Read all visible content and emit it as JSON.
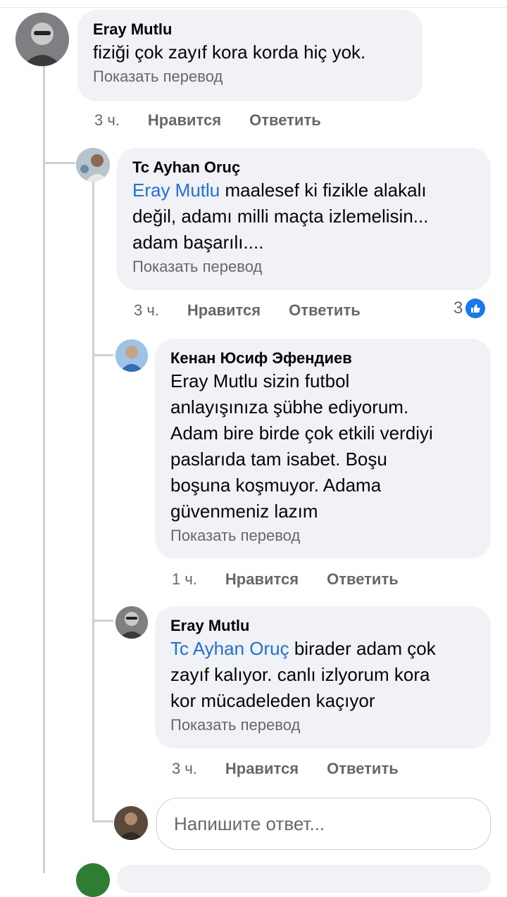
{
  "comments": [
    {
      "author": "Eray Mutlu",
      "mention": "",
      "lines": [
        "fiziği çok zayıf kora korda hiç yok."
      ],
      "translate": "Показать перевод",
      "time": "3 ч.",
      "like": "Нравится",
      "reply": "Ответить"
    },
    {
      "author": "Tc Ayhan Oruç",
      "mention": "Eray Mutlu",
      "lines": [
        " maalesef ki fizikle alakalı",
        "değil, adamı milli maçta izlemelisin...",
        "adam başarılı...."
      ],
      "translate": "Показать перевод",
      "time": "3 ч.",
      "like": "Нравится",
      "reply": "Ответить",
      "reaction_count": "3",
      "reaction_icon": "thumbs-up-icon",
      "reaction_color": "#1877f2"
    },
    {
      "author": "Кенан Юсиф Эфендиев",
      "mention": "",
      "lines": [
        "Eray Mutlu sizin futbol",
        "anlayışınıza şübhe ediyorum.",
        "Adam bire birde çok etkili verdiyi",
        "paslarıda tam isabet. Boşu",
        "boşuna koşmuyor. Adama",
        "güvenmeniz lazım"
      ],
      "translate": "Показать перевод",
      "time": "1 ч.",
      "like": "Нравится",
      "reply": "Ответить"
    },
    {
      "author": "Eray Mutlu",
      "mention": "Tc Ayhan Oruç",
      "lines": [
        " birader adam çok",
        "zayıf kalıyor. canlı izlyorum kora",
        "kor mücadeleden kaçıyor"
      ],
      "translate": "Показать перевод",
      "time": "3 ч.",
      "like": "Нравится",
      "reply": "Ответить"
    }
  ],
  "reply_box": {
    "placeholder": "Напишите ответ..."
  },
  "colors": {
    "link": "#216fdb",
    "bubble": "#f0f2f5",
    "muted": "#65676b"
  }
}
